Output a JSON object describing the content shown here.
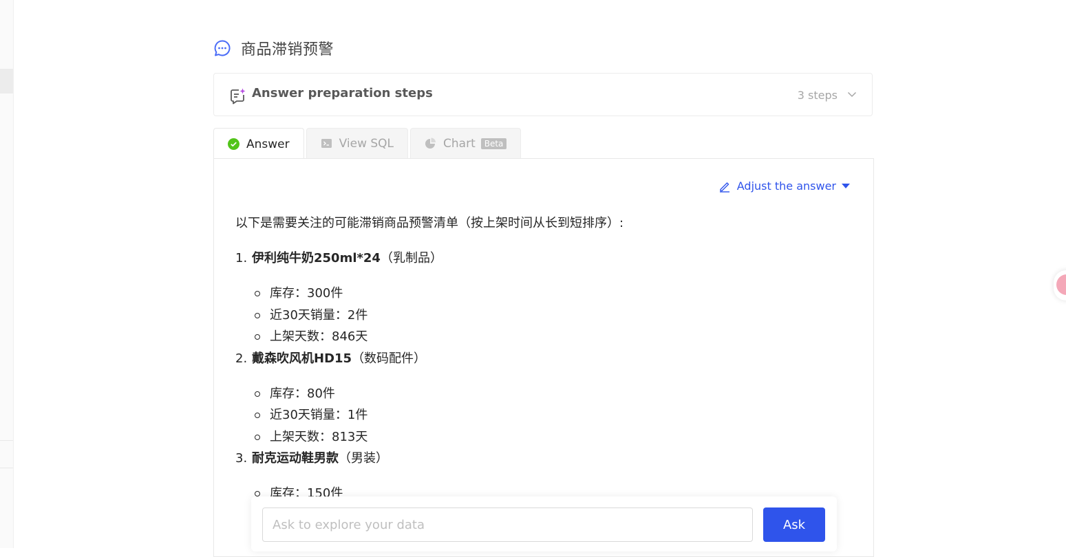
{
  "question": {
    "title": "商品滞销预警"
  },
  "steps": {
    "title": "Answer preparation steps",
    "count_label": "3 steps"
  },
  "tabs": [
    {
      "label": "Answer",
      "active": true,
      "icon": "check-circle-icon"
    },
    {
      "label": "View SQL",
      "active": false,
      "icon": "terminal-icon"
    },
    {
      "label": "Chart",
      "active": false,
      "icon": "pie-chart-icon",
      "badge": "Beta"
    }
  ],
  "adjust": {
    "label": "Adjust the answer"
  },
  "answer": {
    "intro": "以下是需要关注的可能滞销商品预警清单（按上架时间从长到短排序）:",
    "items": [
      {
        "num": "1.",
        "name": "伊利纯牛奶250ml*24",
        "category": "（乳制品）",
        "details": [
          "库存：300件",
          "近30天销量：2件",
          "上架天数：846天"
        ]
      },
      {
        "num": "2.",
        "name": "戴森吹风机HD15",
        "category": "（数码配件）",
        "details": [
          "库存：80件",
          "近30天销量：1件",
          "上架天数：813天"
        ]
      },
      {
        "num": "3.",
        "name": "耐克运动鞋男款",
        "category": "（男装）",
        "details": [
          "库存：150件"
        ]
      }
    ]
  },
  "ask": {
    "placeholder": "Ask to explore your data",
    "button_label": "Ask"
  },
  "colors": {
    "accent": "#2f54eb",
    "success": "#52c41a",
    "question_icon": "#4a6cf7"
  }
}
